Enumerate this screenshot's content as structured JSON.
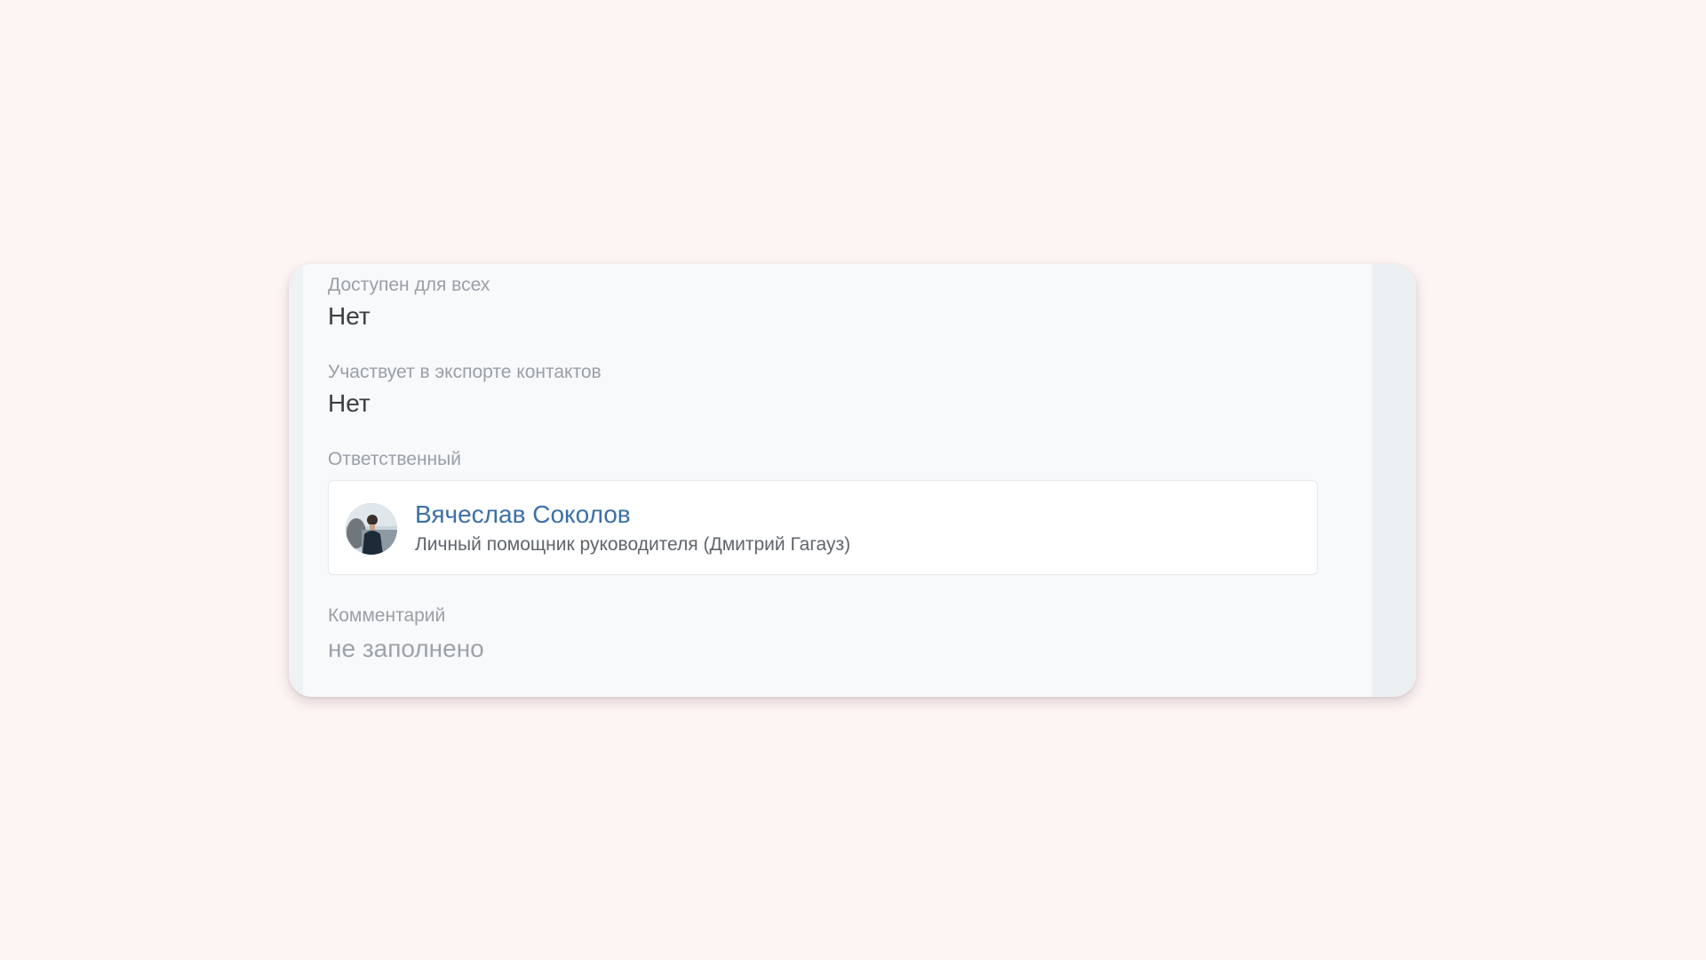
{
  "fields": [
    {
      "label": "Доступен для всех",
      "value": "Нет"
    },
    {
      "label": "Участвует в экспорте контактов",
      "value": "Нет"
    }
  ],
  "responsible": {
    "label": "Ответственный",
    "name": "Вячеслав Соколов",
    "position": "Личный помощник руководителя (Дмитрий Гагауз)"
  },
  "comment": {
    "label": "Комментарий",
    "value": "не заполнено"
  },
  "colors": {
    "page_background": "#fdf4f4",
    "card_background": "#f7f9fb",
    "link": "#3c6fa8",
    "label": "#9aa0a6",
    "value": "#3b3f44"
  }
}
